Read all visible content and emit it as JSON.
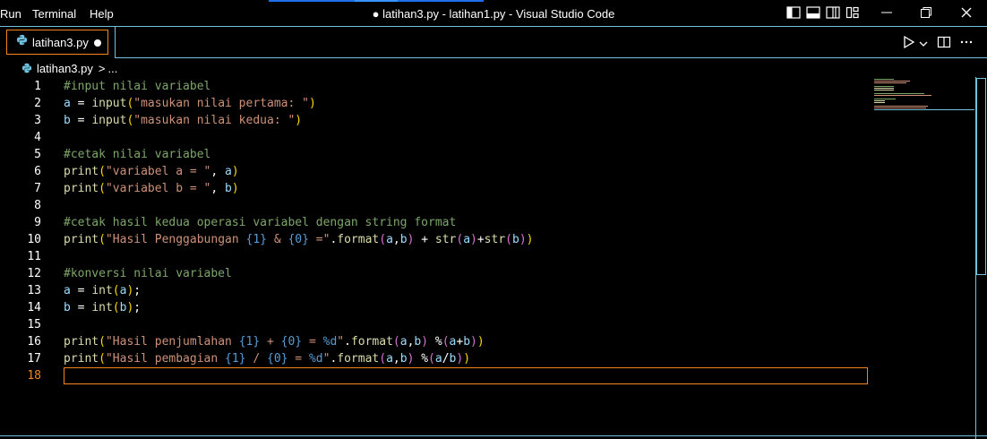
{
  "menu": {
    "run": "Run",
    "terminal": "Terminal",
    "help": "Help"
  },
  "window": {
    "title": "● latihan3.py - latihan1.py - Visual Studio Code"
  },
  "tab": {
    "label": "latihan3.py"
  },
  "breadcrumb": {
    "file": "latihan3.py",
    "sep": ">",
    "more": "..."
  },
  "editor": {
    "line_numbers": [
      "1",
      "2",
      "3",
      "4",
      "5",
      "6",
      "7",
      "8",
      "9",
      "10",
      "11",
      "12",
      "13",
      "14",
      "15",
      "16",
      "17",
      "18"
    ],
    "active_line": "18",
    "lines": [
      [
        [
          "#input nilai variabel",
          "t-comment"
        ]
      ],
      [
        [
          "a",
          "t-var"
        ],
        [
          " = ",
          "t-op"
        ],
        [
          "input",
          "t-fn"
        ],
        [
          "(",
          "t-b1"
        ],
        [
          "\"masukan nilai pertama: \"",
          "t-str"
        ],
        [
          ")",
          "t-b1"
        ]
      ],
      [
        [
          "b",
          "t-var"
        ],
        [
          " = ",
          "t-op"
        ],
        [
          "input",
          "t-fn"
        ],
        [
          "(",
          "t-b1"
        ],
        [
          "\"masukan nilai kedua: \"",
          "t-str"
        ],
        [
          ")",
          "t-b1"
        ]
      ],
      [],
      [
        [
          "#cetak nilai variabel",
          "t-comment"
        ]
      ],
      [
        [
          "print",
          "t-fn"
        ],
        [
          "(",
          "t-b1"
        ],
        [
          "\"variabel a = \"",
          "t-str"
        ],
        [
          ", ",
          "t-op"
        ],
        [
          "a",
          "t-var"
        ],
        [
          ")",
          "t-b1"
        ]
      ],
      [
        [
          "print",
          "t-fn"
        ],
        [
          "(",
          "t-b1"
        ],
        [
          "\"variabel b = \"",
          "t-str"
        ],
        [
          ", ",
          "t-op"
        ],
        [
          "b",
          "t-var"
        ],
        [
          ")",
          "t-b1"
        ]
      ],
      [],
      [
        [
          "#cetak hasil kedua operasi variabel dengan string format",
          "t-comment"
        ]
      ],
      [
        [
          "print",
          "t-fn"
        ],
        [
          "(",
          "t-b1"
        ],
        [
          "\"Hasil Penggabungan ",
          "t-str"
        ],
        [
          "{1}",
          "t-ph"
        ],
        [
          " & ",
          "t-str"
        ],
        [
          "{0}",
          "t-ph"
        ],
        [
          " =\"",
          "t-str"
        ],
        [
          ".",
          "t-op"
        ],
        [
          "format",
          "t-fn"
        ],
        [
          "(",
          "t-b2"
        ],
        [
          "a",
          "t-var"
        ],
        [
          ",",
          "t-op"
        ],
        [
          "b",
          "t-var"
        ],
        [
          ")",
          "t-b2"
        ],
        [
          " + ",
          "t-op"
        ],
        [
          "str",
          "t-fn"
        ],
        [
          "(",
          "t-b2"
        ],
        [
          "a",
          "t-var"
        ],
        [
          ")",
          "t-b2"
        ],
        [
          "+",
          "t-op"
        ],
        [
          "str",
          "t-fn"
        ],
        [
          "(",
          "t-b2"
        ],
        [
          "b",
          "t-var"
        ],
        [
          ")",
          "t-b2"
        ],
        [
          ")",
          "t-b1"
        ]
      ],
      [],
      [
        [
          "#konversi nilai variabel",
          "t-comment"
        ]
      ],
      [
        [
          "a",
          "t-var"
        ],
        [
          " = ",
          "t-op"
        ],
        [
          "int",
          "t-fn"
        ],
        [
          "(",
          "t-b1"
        ],
        [
          "a",
          "t-var"
        ],
        [
          ")",
          "t-b1"
        ],
        [
          ";",
          "t-op"
        ]
      ],
      [
        [
          "b",
          "t-var"
        ],
        [
          " = ",
          "t-op"
        ],
        [
          "int",
          "t-fn"
        ],
        [
          "(",
          "t-b1"
        ],
        [
          "b",
          "t-var"
        ],
        [
          ")",
          "t-b1"
        ],
        [
          ";",
          "t-op"
        ]
      ],
      [],
      [
        [
          "print",
          "t-fn"
        ],
        [
          "(",
          "t-b1"
        ],
        [
          "\"Hasil penjumlahan ",
          "t-str"
        ],
        [
          "{1}",
          "t-ph"
        ],
        [
          " + ",
          "t-str"
        ],
        [
          "{0}",
          "t-ph"
        ],
        [
          " = ",
          "t-str"
        ],
        [
          "%d",
          "t-ph"
        ],
        [
          "\"",
          "t-str"
        ],
        [
          ".",
          "t-op"
        ],
        [
          "format",
          "t-fn"
        ],
        [
          "(",
          "t-b2"
        ],
        [
          "a",
          "t-var"
        ],
        [
          ",",
          "t-op"
        ],
        [
          "b",
          "t-var"
        ],
        [
          ")",
          "t-b2"
        ],
        [
          " %",
          "t-op"
        ],
        [
          "(",
          "t-b2"
        ],
        [
          "a",
          "t-var"
        ],
        [
          "+",
          "t-op"
        ],
        [
          "b",
          "t-var"
        ],
        [
          ")",
          "t-b2"
        ],
        [
          ")",
          "t-b1"
        ]
      ],
      [
        [
          "print",
          "t-fn"
        ],
        [
          "(",
          "t-b1"
        ],
        [
          "\"Hasil pembagian ",
          "t-str"
        ],
        [
          "{1}",
          "t-ph"
        ],
        [
          " / ",
          "t-str"
        ],
        [
          "{0}",
          "t-ph"
        ],
        [
          " = ",
          "t-str"
        ],
        [
          "%d",
          "t-ph"
        ],
        [
          "\"",
          "t-str"
        ],
        [
          ".",
          "t-op"
        ],
        [
          "format",
          "t-fn"
        ],
        [
          "(",
          "t-b2"
        ],
        [
          "a",
          "t-var"
        ],
        [
          ",",
          "t-op"
        ],
        [
          "b",
          "t-var"
        ],
        [
          ")",
          "t-b2"
        ],
        [
          " %",
          "t-op"
        ],
        [
          "(",
          "t-b2"
        ],
        [
          "a",
          "t-var"
        ],
        [
          "/",
          "t-op"
        ],
        [
          "b",
          "t-var"
        ],
        [
          ")",
          "t-b2"
        ],
        [
          ")",
          "t-b1"
        ]
      ],
      []
    ]
  },
  "colors": {
    "accent_border": "#6fc3df",
    "active_border": "#f38518",
    "comment": "#7ca668",
    "string": "#ce9178",
    "function": "#dcdcaa",
    "variable": "#9cdcfe",
    "placeholder": "#569cd6"
  },
  "icons": {
    "python": "python-file-icon",
    "run": "run-icon",
    "split": "split-editor-icon",
    "more": "more-actions-icon"
  }
}
